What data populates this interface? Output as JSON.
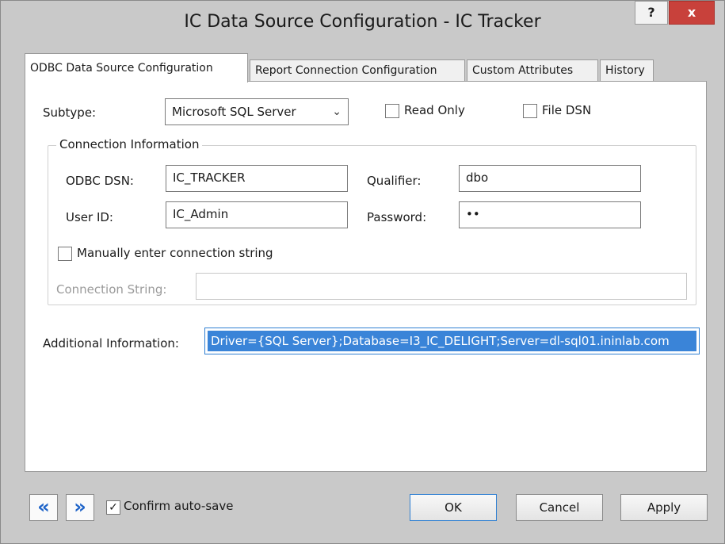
{
  "window": {
    "title": "IC Data Source Configuration - IC Tracker",
    "help_label": "?",
    "close_label": "x"
  },
  "tabs": [
    {
      "label": "ODBC Data Source Configuration",
      "active": true
    },
    {
      "label": "Report Connection Configuration",
      "active": false
    },
    {
      "label": "Custom Attributes",
      "active": false
    },
    {
      "label": "History",
      "active": false
    }
  ],
  "form": {
    "subtype_label": "Subtype:",
    "subtype_value": "Microsoft SQL Server",
    "read_only_label": "Read Only",
    "read_only_checked": false,
    "file_dsn_label": "File DSN",
    "file_dsn_checked": false,
    "group_title": "Connection Information",
    "odbc_dsn_label": "ODBC DSN:",
    "odbc_dsn_value": "IC_TRACKER",
    "qualifier_label": "Qualifier:",
    "qualifier_value": "dbo",
    "user_id_label": "User ID:",
    "user_id_value": "IC_Admin",
    "password_label": "Password:",
    "password_value": "••",
    "manual_label": "Manually enter connection string",
    "manual_checked": false,
    "conn_string_label": "Connection String:",
    "conn_string_value": "",
    "additional_label": "Additional Information:",
    "additional_value": "Driver={SQL Server};Database=I3_IC_DELIGHT;Server=dl-sql01.ininlab.com"
  },
  "footer": {
    "prev_glyph": "«",
    "next_glyph": "»",
    "confirm_label": "Confirm auto-save",
    "confirm_checked": true,
    "check_glyph": "✓",
    "ok_label": "OK",
    "cancel_label": "Cancel",
    "apply_label": "Apply"
  },
  "colors": {
    "accent": "#1e63c8",
    "selection": "#3a84d8",
    "close": "#c8413b"
  }
}
